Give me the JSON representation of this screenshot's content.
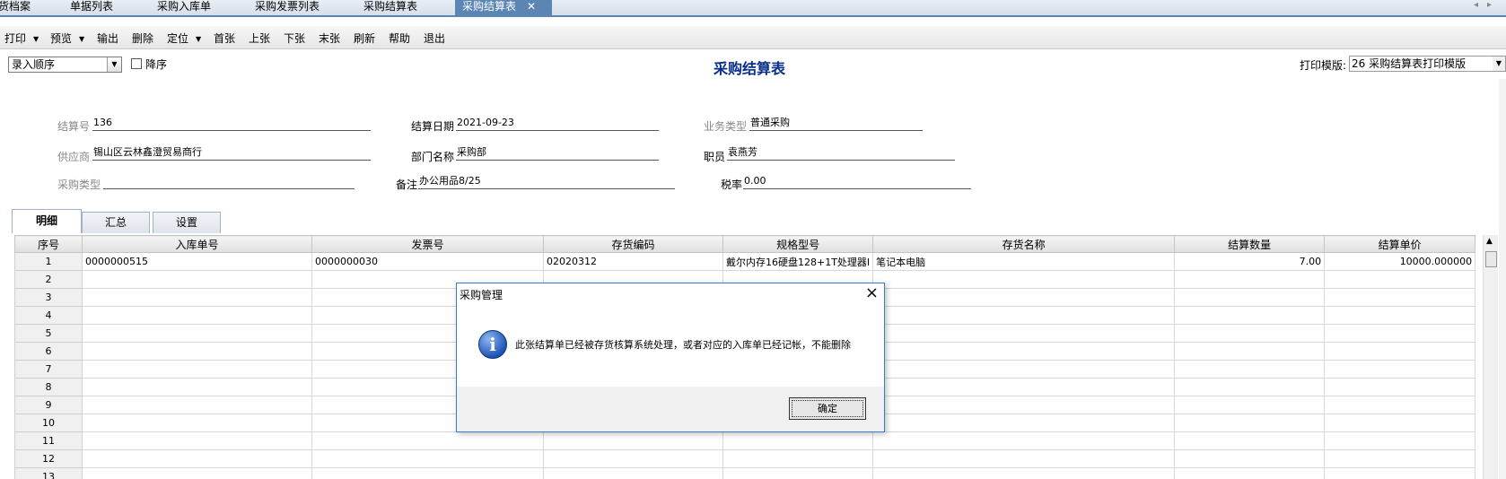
{
  "tabs": [
    {
      "label": "货档案"
    },
    {
      "label": "单据列表"
    },
    {
      "label": "采购入库单"
    },
    {
      "label": "采购发票列表"
    },
    {
      "label": "采购结算表"
    },
    {
      "label": "采购结算表",
      "close": "✕"
    }
  ],
  "toolbar": {
    "print": "打印",
    "preview": "预览",
    "export": "输出",
    "delete": "删除",
    "locate": "定位",
    "first": "首张",
    "prev": "上张",
    "next": "下张",
    "last": "末张",
    "refresh": "刷新",
    "help": "帮助",
    "exit": "退出"
  },
  "sort": {
    "value": "录入顺序",
    "desc_label": "降序"
  },
  "page_title": "采购结算表",
  "template": {
    "label": "打印模版:",
    "value": "26 采购结算表打印模版"
  },
  "fields": {
    "settle_no": {
      "label": "结算号",
      "value": "136"
    },
    "settle_date": {
      "label": "结算日期",
      "value": "2021-09-23"
    },
    "biz_type": {
      "label": "业务类型",
      "value": "普通采购"
    },
    "supplier": {
      "label": "供应商",
      "value": "锡山区云林鑫澄贸易商行"
    },
    "dept": {
      "label": "部门名称",
      "value": "采购部"
    },
    "staff": {
      "label": "职员",
      "value": "袁燕芳"
    },
    "purchase_type": {
      "label": "采购类型",
      "value": ""
    },
    "remark": {
      "label": "备注",
      "value": "办公用品8/25"
    },
    "tax_rate": {
      "label": "税率",
      "value": "0.00"
    }
  },
  "detail_tabs": [
    "明细",
    "汇总",
    "设置"
  ],
  "grid": {
    "columns": [
      "序号",
      "入库单号",
      "发票号",
      "存货编码",
      "规格型号",
      "存货名称",
      "结算数量",
      "结算单价"
    ],
    "rows": [
      [
        "1",
        "0000000515",
        "0000000030",
        "02020312",
        "戴尔内存16硬盘128+1T处理器I",
        "笔记本电脑",
        "7.00",
        "10000.000000"
      ],
      [
        "2",
        "",
        "",
        "",
        "",
        "",
        "",
        ""
      ],
      [
        "3",
        "",
        "",
        "",
        "",
        "",
        "",
        ""
      ],
      [
        "4",
        "",
        "",
        "",
        "",
        "",
        "",
        ""
      ],
      [
        "5",
        "",
        "",
        "",
        "",
        "",
        "",
        ""
      ],
      [
        "6",
        "",
        "",
        "",
        "",
        "",
        "",
        ""
      ],
      [
        "7",
        "",
        "",
        "",
        "",
        "",
        "",
        ""
      ],
      [
        "8",
        "",
        "",
        "",
        "",
        "",
        "",
        ""
      ],
      [
        "9",
        "",
        "",
        "",
        "",
        "",
        "",
        ""
      ],
      [
        "10",
        "",
        "",
        "",
        "",
        "",
        "",
        ""
      ],
      [
        "11",
        "",
        "",
        "",
        "",
        "",
        "",
        ""
      ],
      [
        "12",
        "",
        "",
        "",
        "",
        "",
        "",
        ""
      ],
      [
        "13",
        "",
        "",
        "",
        "",
        "",
        "",
        ""
      ]
    ]
  },
  "dialog": {
    "title": "采购管理",
    "message": "此张结算单已经被存货核算系统处理，或者对应的入库单已经记帐，不能删除",
    "ok": "确定",
    "icon": "info-icon",
    "accent": "#3c7bd4"
  },
  "colors": {
    "tab_active": "#5b86b4",
    "title": "#0a2f8a"
  }
}
